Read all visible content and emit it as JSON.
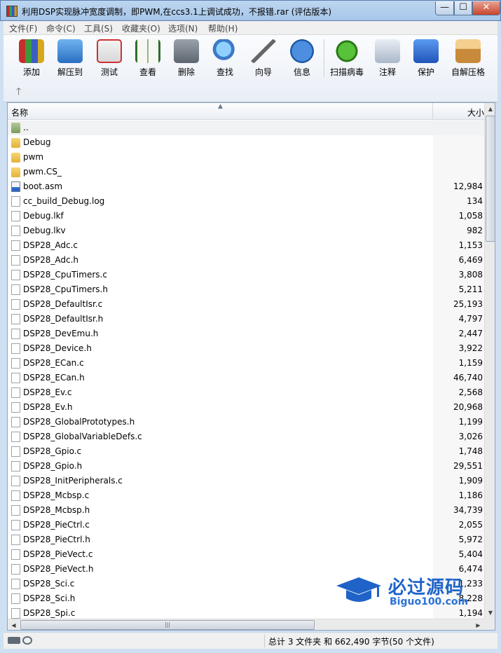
{
  "window": {
    "title": "利用DSP实现脉冲宽度调制，即PWM,在ccs3.1上调试成功，不报错.rar (评估版本)",
    "minimize": "—",
    "maximize": "☐",
    "close": "✕"
  },
  "menu": [
    "文件(F)",
    "命令(C)",
    "工具(S)",
    "收藏夹(O)",
    "选项(N)",
    "帮助(H)"
  ],
  "toolbar": [
    {
      "label": "添加",
      "icon": "add-archive-icon"
    },
    {
      "label": "解压到",
      "icon": "extract-icon"
    },
    {
      "label": "测试",
      "icon": "test-icon"
    },
    {
      "label": "查看",
      "icon": "view-book-icon"
    },
    {
      "label": "删除",
      "icon": "trash-icon"
    },
    {
      "label": "查找",
      "icon": "magnifier-icon"
    },
    {
      "label": "向导",
      "icon": "wizard-icon"
    },
    {
      "label": "信息",
      "icon": "info-icon"
    },
    {
      "label": "扫描病毒",
      "icon": "virus-scan-icon"
    },
    {
      "label": "注释",
      "icon": "comment-icon"
    },
    {
      "label": "保护",
      "icon": "shield-icon"
    },
    {
      "label": "自解压格",
      "icon": "sfx-box-icon"
    }
  ],
  "up_arrow": "🡑",
  "columns": {
    "name": "名称",
    "size": "大小"
  },
  "files": [
    {
      "name": "..",
      "size": "",
      "type": "up"
    },
    {
      "name": "Debug",
      "size": "",
      "type": "folder"
    },
    {
      "name": "pwm",
      "size": "",
      "type": "folder"
    },
    {
      "name": "pwm.CS_",
      "size": "",
      "type": "folder"
    },
    {
      "name": "boot.asm",
      "size": "12,984",
      "type": "asm"
    },
    {
      "name": "cc_build_Debug.log",
      "size": "134",
      "type": "file"
    },
    {
      "name": "Debug.lkf",
      "size": "1,058",
      "type": "file"
    },
    {
      "name": "Debug.lkv",
      "size": "982",
      "type": "file"
    },
    {
      "name": "DSP28_Adc.c",
      "size": "1,153",
      "type": "file"
    },
    {
      "name": "DSP28_Adc.h",
      "size": "6,469",
      "type": "file"
    },
    {
      "name": "DSP28_CpuTimers.c",
      "size": "3,808",
      "type": "file"
    },
    {
      "name": "DSP28_CpuTimers.h",
      "size": "5,211",
      "type": "file"
    },
    {
      "name": "DSP28_DefaultIsr.c",
      "size": "25,193",
      "type": "file"
    },
    {
      "name": "DSP28_DefaultIsr.h",
      "size": "4,797",
      "type": "file"
    },
    {
      "name": "DSP28_DevEmu.h",
      "size": "2,447",
      "type": "file"
    },
    {
      "name": "DSP28_Device.h",
      "size": "3,922",
      "type": "file"
    },
    {
      "name": "DSP28_ECan.c",
      "size": "1,159",
      "type": "file"
    },
    {
      "name": "DSP28_ECan.h",
      "size": "46,740",
      "type": "file"
    },
    {
      "name": "DSP28_Ev.c",
      "size": "2,568",
      "type": "file"
    },
    {
      "name": "DSP28_Ev.h",
      "size": "20,968",
      "type": "file"
    },
    {
      "name": "DSP28_GlobalPrototypes.h",
      "size": "1,199",
      "type": "file"
    },
    {
      "name": "DSP28_GlobalVariableDefs.c",
      "size": "3,026",
      "type": "file"
    },
    {
      "name": "DSP28_Gpio.c",
      "size": "1,748",
      "type": "file"
    },
    {
      "name": "DSP28_Gpio.h",
      "size": "29,551",
      "type": "file"
    },
    {
      "name": "DSP28_InitPeripherals.c",
      "size": "1,909",
      "type": "file"
    },
    {
      "name": "DSP28_Mcbsp.c",
      "size": "1,186",
      "type": "file"
    },
    {
      "name": "DSP28_Mcbsp.h",
      "size": "34,739",
      "type": "file"
    },
    {
      "name": "DSP28_PieCtrl.c",
      "size": "2,055",
      "type": "file"
    },
    {
      "name": "DSP28_PieCtrl.h",
      "size": "5,972",
      "type": "file"
    },
    {
      "name": "DSP28_PieVect.c",
      "size": "5,404",
      "type": "file"
    },
    {
      "name": "DSP28_PieVect.h",
      "size": "6,474",
      "type": "file"
    },
    {
      "name": "DSP28_Sci.c",
      "size": "1,233",
      "type": "file"
    },
    {
      "name": "DSP28_Sci.h",
      "size": "8,228",
      "type": "file"
    },
    {
      "name": "DSP28_Spi.c",
      "size": "1,194",
      "type": "file"
    }
  ],
  "scroll": {
    "up": "▲",
    "down": "▼",
    "left": "◀",
    "right": "▶",
    "grip": "|||"
  },
  "status": {
    "text": "总计 3 文件夹 和 662,490 字节(50 个文件)"
  },
  "watermark": {
    "main": "必过源码",
    "sub": "Biguo100.com"
  }
}
